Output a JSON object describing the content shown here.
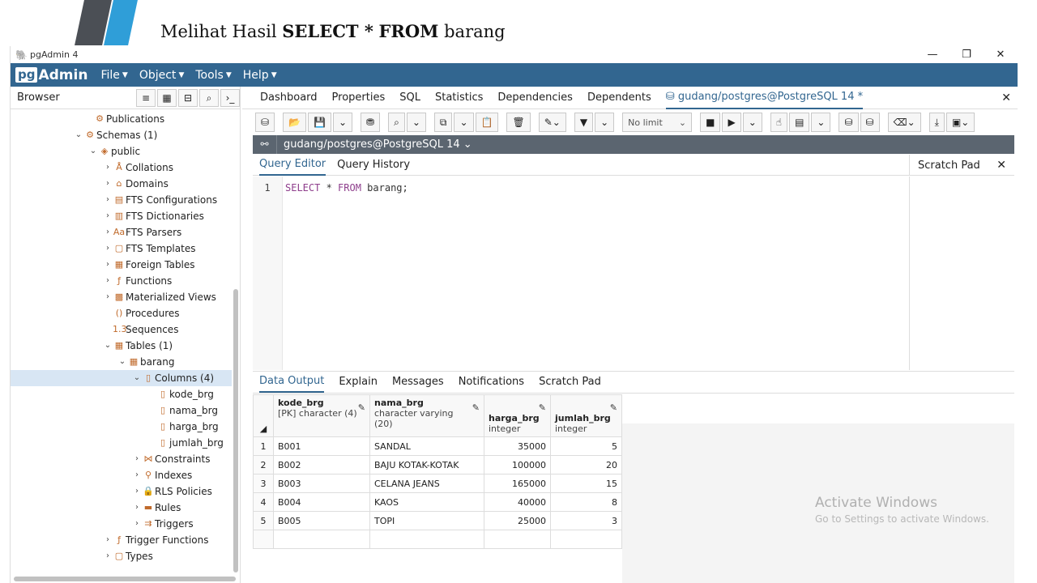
{
  "slide": {
    "title_prefix": "Melihat Hasil ",
    "title_bold1": "SELECT *",
    "title_bold2": "FROM",
    "title_suffix": "barang"
  },
  "window": {
    "title": "pgAdmin 4",
    "minimize": "—",
    "maximize": "❐",
    "close": "✕"
  },
  "menubar": {
    "logo_pg": "pg",
    "logo_admin": "Admin",
    "items": [
      "File",
      "Object",
      "Tools",
      "Help"
    ]
  },
  "browser": {
    "label": "Browser",
    "tree": [
      {
        "label": "Publications",
        "indent": 0
      },
      {
        "label": "Schemas (1)",
        "indent": 0
      },
      {
        "label": "public",
        "indent": 1
      },
      {
        "label": "Collations",
        "indent": 2
      },
      {
        "label": "Domains",
        "indent": 2
      },
      {
        "label": "FTS Configurations",
        "indent": 2
      },
      {
        "label": "FTS Dictionaries",
        "indent": 2
      },
      {
        "label": "FTS Parsers",
        "indent": 2
      },
      {
        "label": "FTS Templates",
        "indent": 2
      },
      {
        "label": "Foreign Tables",
        "indent": 2
      },
      {
        "label": "Functions",
        "indent": 2
      },
      {
        "label": "Materialized Views",
        "indent": 2
      },
      {
        "label": "Procedures",
        "indent": 2
      },
      {
        "label": "Sequences",
        "indent": 2
      },
      {
        "label": "Tables (1)",
        "indent": 2
      },
      {
        "label": "barang",
        "indent": 3
      },
      {
        "label": "Columns (4)",
        "indent": 4
      },
      {
        "label": "kode_brg",
        "indent": 5
      },
      {
        "label": "nama_brg",
        "indent": 5
      },
      {
        "label": "harga_brg",
        "indent": 5
      },
      {
        "label": "jumlah_brg",
        "indent": 5
      },
      {
        "label": "Constraints",
        "indent": 4
      },
      {
        "label": "Indexes",
        "indent": 4
      },
      {
        "label": "RLS Policies",
        "indent": 4
      },
      {
        "label": "Rules",
        "indent": 4
      },
      {
        "label": "Triggers",
        "indent": 4
      },
      {
        "label": "Trigger Functions",
        "indent": 2
      },
      {
        "label": "Types",
        "indent": 2
      }
    ]
  },
  "tabs": [
    "Dashboard",
    "Properties",
    "SQL",
    "Statistics",
    "Dependencies",
    "Dependents",
    "gudang/postgres@PostgreSQL 14 *"
  ],
  "toolbar": {
    "limit_label": "No limit"
  },
  "connection": {
    "name": "gudang/postgres@PostgreSQL 14"
  },
  "query_tabs": [
    "Query Editor",
    "Query History"
  ],
  "scratch_pad": "Scratch Pad",
  "editor": {
    "line_number": "1",
    "kw1": "SELECT",
    "mid": " * ",
    "kw2": "FROM",
    "rest": " barang;"
  },
  "data_tabs": [
    "Data Output",
    "Explain",
    "Messages",
    "Notifications",
    "Scratch Pad"
  ],
  "grid": {
    "columns": [
      {
        "name": "kode_brg",
        "type": "[PK] character (4)"
      },
      {
        "name": "nama_brg",
        "type": "character varying (20)"
      },
      {
        "name": "harga_brg",
        "type": "integer"
      },
      {
        "name": "jumlah_brg",
        "type": "integer"
      }
    ],
    "rows": [
      [
        "1",
        "B001",
        "SANDAL",
        "35000",
        "5"
      ],
      [
        "2",
        "B002",
        "BAJU KOTAK-KOTAK",
        "100000",
        "20"
      ],
      [
        "3",
        "B003",
        "CELANA JEANS",
        "165000",
        "15"
      ],
      [
        "4",
        "B004",
        "KAOS",
        "40000",
        "8"
      ],
      [
        "5",
        "B005",
        "TOPI",
        "25000",
        "3"
      ]
    ]
  },
  "watermark": {
    "line1": "Activate Windows",
    "line2": "Go to Settings to activate Windows."
  }
}
